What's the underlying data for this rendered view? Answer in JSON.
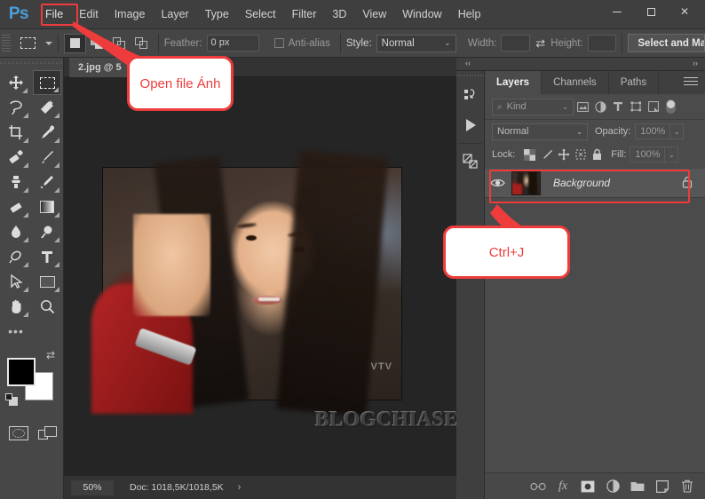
{
  "app": {
    "logo": "Ps"
  },
  "menubar": {
    "items": [
      "File",
      "Edit",
      "Image",
      "Layer",
      "Type",
      "Select",
      "Filter",
      "3D",
      "View",
      "Window",
      "Help"
    ],
    "highlighted": "File"
  },
  "window_controls": {
    "minimize": "minimize-icon",
    "maximize": "maximize-icon",
    "close": "✕"
  },
  "options_bar": {
    "tool_icon": "rectangular-marquee-icon",
    "selection_modes": [
      "new-selection",
      "add-to-selection",
      "subtract-from-selection",
      "intersect-with-selection"
    ],
    "feather_label": "Feather:",
    "feather_value": "0 px",
    "antialias_label": "Anti-alias",
    "style_label": "Style:",
    "style_value": "Normal",
    "width_label": "Width:",
    "width_value": "",
    "height_label": "Height:",
    "height_value": "",
    "swap_icon": "swap-arrows-icon",
    "select_and_mask": "Select and Ma"
  },
  "toolbar": {
    "tools": [
      [
        "move-tool",
        "rectangular-marquee-tool"
      ],
      [
        "lasso-tool",
        "quick-selection-tool"
      ],
      [
        "crop-tool",
        "eyedropper-tool"
      ],
      [
        "healing-brush-tool",
        "brush-tool"
      ],
      [
        "clone-stamp-tool",
        "history-brush-tool"
      ],
      [
        "eraser-tool",
        "gradient-tool"
      ],
      [
        "blur-tool",
        "dodge-tool"
      ],
      [
        "pen-tool",
        "type-tool"
      ],
      [
        "path-selection-tool",
        "rectangle-tool"
      ],
      [
        "hand-tool",
        "zoom-tool"
      ]
    ],
    "more_tools": "edit-toolbar-icon",
    "foreground_color": "#000000",
    "background_color": "#ffffff",
    "swap_colors": "swap-colors-icon",
    "default_colors": "default-colors-icon",
    "quick_mask": "quick-mask-icon",
    "screen_mode": "screen-mode-icon"
  },
  "document": {
    "tab_label": "2.jpg @ 5",
    "zoom": "50%",
    "doc_info": "Doc: 1018,5K/1018,5K",
    "doc_arrow": "›",
    "watermark": "BLOGCHIASEKIENTHUC.COM",
    "image_label": "VTV"
  },
  "dock": {
    "collapse_left": "‹‹",
    "collapse_right": "››",
    "rail_icons": [
      "history-icon",
      "actions-play-icon",
      "adjustments-icon"
    ]
  },
  "layers_panel": {
    "tabs": [
      {
        "label": "Layers",
        "active": true
      },
      {
        "label": "Channels",
        "active": false
      },
      {
        "label": "Paths",
        "active": false
      }
    ],
    "menu_icon": "panel-menu-icon",
    "filter": {
      "kind_label": "Kind",
      "search_icon": "search-icon",
      "chevron": "⌄",
      "icons": [
        "filter-pixel-icon",
        "filter-adjustment-icon",
        "filter-type-icon",
        "filter-shape-icon",
        "filter-smart-object-icon"
      ],
      "toggle": "filter-toggle"
    },
    "blend_mode": "Normal",
    "opacity_label": "Opacity:",
    "opacity_value": "100%",
    "lock_label": "Lock:",
    "lock_icons": [
      "lock-transparent-pixels-icon",
      "lock-image-pixels-icon",
      "lock-position-icon",
      "lock-artboard-icon",
      "lock-all-icon"
    ],
    "fill_label": "Fill:",
    "fill_value": "100%",
    "layers": [
      {
        "name": "Background",
        "visible": true,
        "locked": true,
        "eye_icon": "eye-icon",
        "lock_icon": "lock-icon",
        "thumbnail": "layer-thumbnail"
      }
    ],
    "bottom_icons": [
      "link-layers-icon",
      "layer-style-fx-icon",
      "add-layer-mask-icon",
      "new-fill-adjustment-layer-icon",
      "new-group-icon",
      "new-layer-icon",
      "delete-layer-icon"
    ]
  },
  "annotations": {
    "accent_color": "#ee3b3b",
    "callouts": [
      {
        "text": "Open file Ánh"
      },
      {
        "text": "Ctrl+J"
      }
    ],
    "highlight_file_menu": "file-menu-highlight",
    "highlight_layer_row": "background-layer-highlight"
  }
}
